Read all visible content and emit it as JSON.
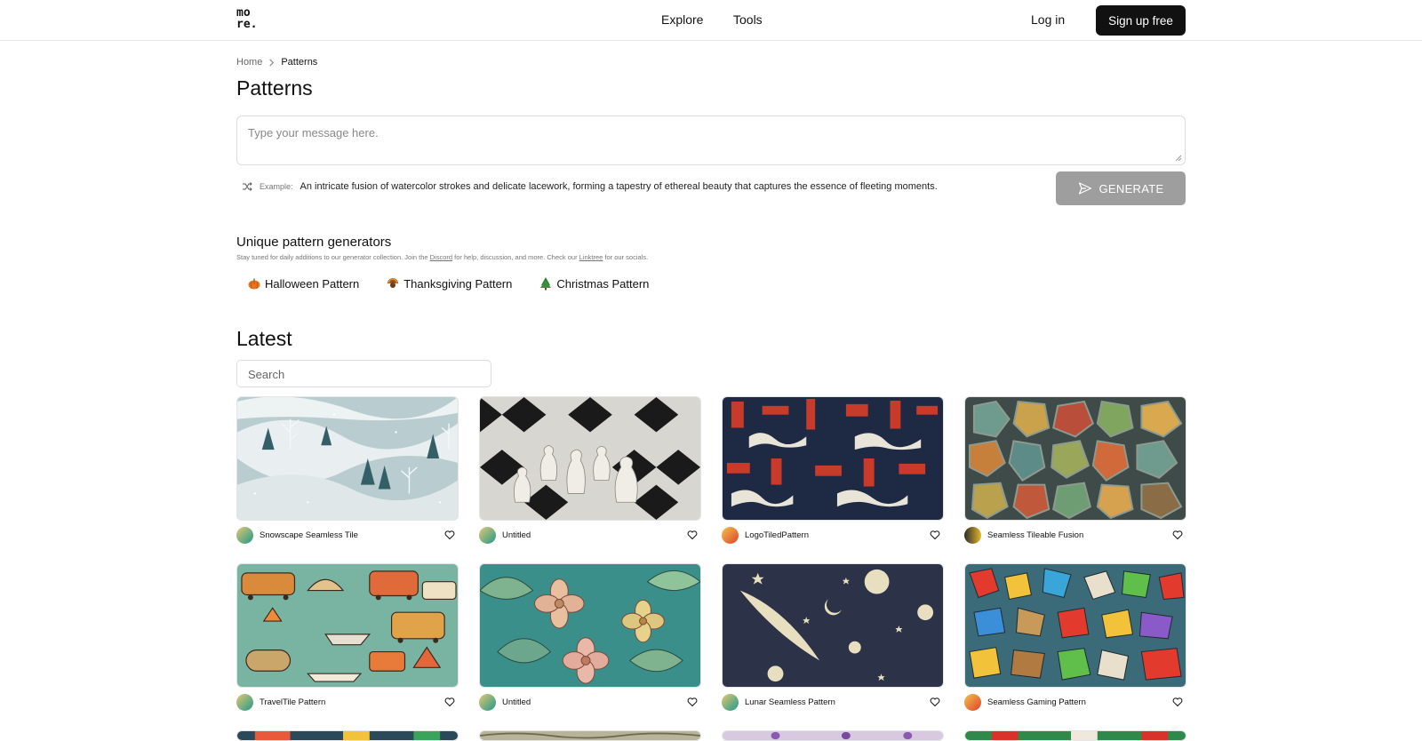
{
  "header": {
    "logo_line1": "mo",
    "logo_line2": "re.",
    "nav": [
      {
        "label": "Explore"
      },
      {
        "label": "Tools"
      }
    ],
    "login_label": "Log in",
    "signup_label": "Sign up free"
  },
  "breadcrumb": {
    "home": "Home",
    "current": "Patterns"
  },
  "page_title": "Patterns",
  "prompt": {
    "placeholder": "Type your message here.",
    "example_label": "Example:",
    "example_text": "An intricate fusion of watercolor strokes and delicate lacework, forming a tapestry of ethereal beauty that captures the essence of fleeting moments.",
    "generate_label": "GENERATE"
  },
  "generators": {
    "title": "Unique pattern generators",
    "subtitle_pre": "Stay tuned for daily additions to our generator collection. Join the ",
    "discord_link": "Discord",
    "subtitle_mid": " for help, discussion, and more. Check our ",
    "linktree_link": "Linktree",
    "subtitle_post": " for our socials.",
    "items": [
      {
        "label": "Halloween Pattern",
        "icon": "pumpkin-icon"
      },
      {
        "label": "Thanksgiving Pattern",
        "icon": "turkey-icon"
      },
      {
        "label": "Christmas Pattern",
        "icon": "christmas-tree-icon"
      }
    ]
  },
  "latest": {
    "title": "Latest",
    "search_placeholder": "Search",
    "cards": [
      {
        "name": "Snowscape Seamless Tile"
      },
      {
        "name": "Untitled"
      },
      {
        "name": "LogoTiledPattern"
      },
      {
        "name": "Seamless Tileable Fusion"
      },
      {
        "name": "TravelTile Pattern"
      },
      {
        "name": "Untitled"
      },
      {
        "name": "Lunar Seamless Pattern"
      },
      {
        "name": "Seamless Gaming Pattern"
      }
    ]
  },
  "colors": {
    "accent_dark": "#111111",
    "generate_disabled": "#9e9e9e"
  }
}
